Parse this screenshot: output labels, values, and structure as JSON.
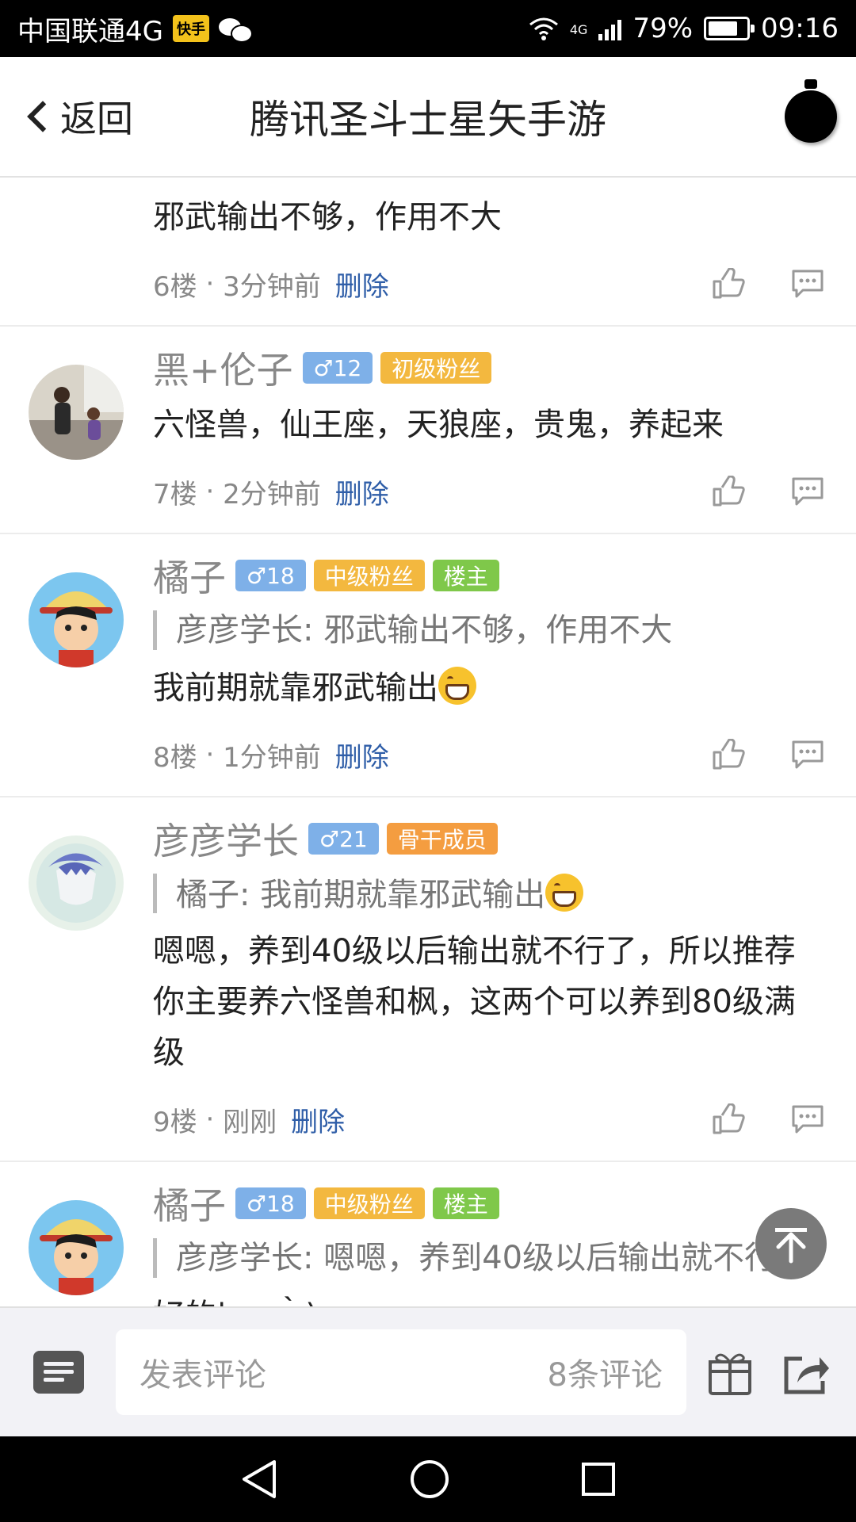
{
  "status_bar": {
    "carrier": "中国联通4G",
    "app_badge": "快手",
    "network": "4G",
    "battery": "79%",
    "battery_level": 0.79,
    "time": "09:16"
  },
  "header": {
    "back_label": "返回",
    "title": "腾讯圣斗士星矢手游"
  },
  "top_comment": {
    "content": "邪武输出不够，作用不大",
    "floor": "6楼",
    "time": "3分钟前",
    "delete_label": "删除"
  },
  "comments": [
    {
      "user": "黑+伦子",
      "level": "♂12",
      "badges": [
        {
          "text": "初级粉丝",
          "color": "#f3b83f"
        }
      ],
      "content": "六怪兽，仙王座，天狼座，贵鬼，养起来",
      "floor": "7楼",
      "time": "2分钟前",
      "delete_label": "删除"
    },
    {
      "user": "橘子",
      "level": "♂18",
      "badges": [
        {
          "text": "中级粉丝",
          "color": "#f3b83f"
        },
        {
          "text": "楼主",
          "color": "#7fc84a"
        }
      ],
      "quote": "彦彦学长: 邪武输出不够，作用不大",
      "content": "我前期就靠邪武输出",
      "floor": "8楼",
      "time": "1分钟前",
      "delete_label": "删除"
    },
    {
      "user": "彦彦学长",
      "level": "♂21",
      "badges": [
        {
          "text": "骨干成员",
          "color": "#f49d40"
        }
      ],
      "quote": "橘子: 我前期就靠邪武输出",
      "content": "嗯嗯，养到40级以后输出就不行了，所以推荐你主要养六怪兽和枫，这两个可以养到80级满级",
      "floor": "9楼",
      "time": "刚刚",
      "delete_label": "删除"
    },
    {
      "user": "橘子",
      "level": "♂18",
      "badges": [
        {
          "text": "中级粉丝",
          "color": "#f3b83f"
        },
        {
          "text": "楼主",
          "color": "#7fc84a"
        }
      ],
      "quote": "彦彦学长: 嗯嗯，养到40级以后输出就不行...",
      "content": "好的|·ω·｀)"
    }
  ],
  "bottom_bar": {
    "input_placeholder": "发表评论",
    "comment_count": "8条评论"
  },
  "colors": {
    "link_blue": "#2f5ea8",
    "level_blue": "#7eb0e8",
    "fan_orange": "#f3b83f",
    "core_orange": "#f49d40",
    "owner_green": "#7fc84a"
  }
}
